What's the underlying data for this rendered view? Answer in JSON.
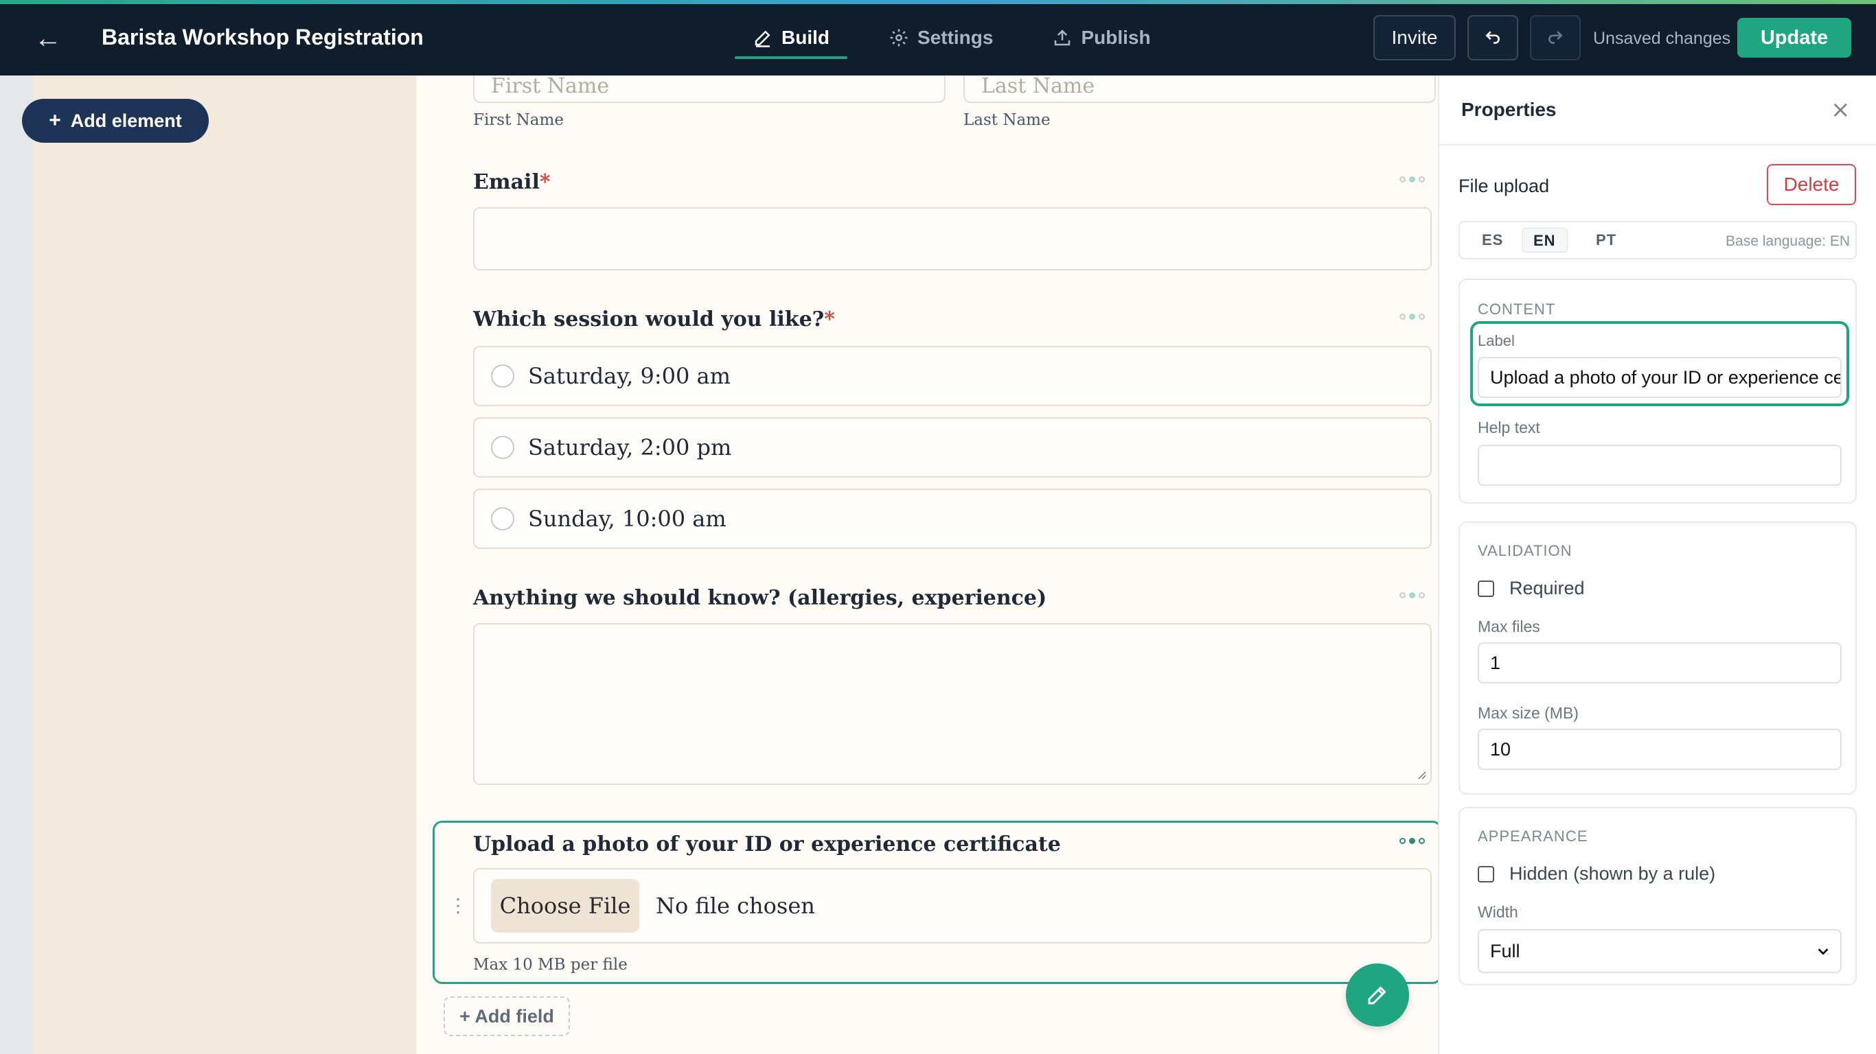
{
  "header": {
    "back_icon": "arrow-left-icon",
    "title": "Barista Workshop Registration",
    "tabs": [
      {
        "label": "Build",
        "icon": "pencil-icon",
        "active": true
      },
      {
        "label": "Settings",
        "icon": "gear-icon",
        "active": false
      },
      {
        "label": "Publish",
        "icon": "upload-icon",
        "active": false
      }
    ],
    "invite_label": "Invite",
    "undo_icon": "undo-icon",
    "redo_icon": "redo-icon",
    "unsaved_text": "Unsaved changes",
    "update_label": "Update",
    "accent_color": "#1fa57f"
  },
  "sidebar": {
    "add_element_label": "Add element",
    "add_element_icon": "plus-icon"
  },
  "form": {
    "name_row": {
      "first_placeholder": "First Name",
      "last_placeholder": "Last Name",
      "first_label": "First Name",
      "last_label": "Last Name"
    },
    "email": {
      "label": "Email",
      "required_mark": "*"
    },
    "session": {
      "label": "Which session would you like?",
      "required_mark": "*",
      "options": [
        "Saturday, 9:00 am",
        "Saturday, 2:00 pm",
        "Sunday, 10:00 am"
      ]
    },
    "notes": {
      "label": "Anything we should know? (allergies, experience)"
    },
    "upload": {
      "label": "Upload a photo of your ID or experience certificate",
      "choose_file": "Choose File",
      "no_file": "No file chosen",
      "hint": "Max 10 MB per file"
    },
    "add_field_label": "+ Add field",
    "fab_icon": "pencil-icon"
  },
  "properties": {
    "title": "Properties",
    "close_icon": "close-icon",
    "element_type": "File upload",
    "delete_label": "Delete",
    "languages": [
      "ES",
      "EN",
      "PT"
    ],
    "active_language": "EN",
    "base_language": "Base language: EN",
    "content": {
      "section_title": "CONTENT",
      "label_label": "Label",
      "label_value": "Upload a photo of your ID or experience certificate",
      "help_label": "Help text",
      "help_value": ""
    },
    "validation": {
      "section_title": "VALIDATION",
      "required_label": "Required",
      "required_checked": false,
      "max_files_label": "Max files",
      "max_files_value": "1",
      "max_size_label": "Max size (MB)",
      "max_size_value": "10"
    },
    "appearance": {
      "section_title": "APPEARANCE",
      "hidden_label": "Hidden (shown by a rule)",
      "hidden_checked": false,
      "width_label": "Width",
      "width_value": "Full"
    }
  }
}
